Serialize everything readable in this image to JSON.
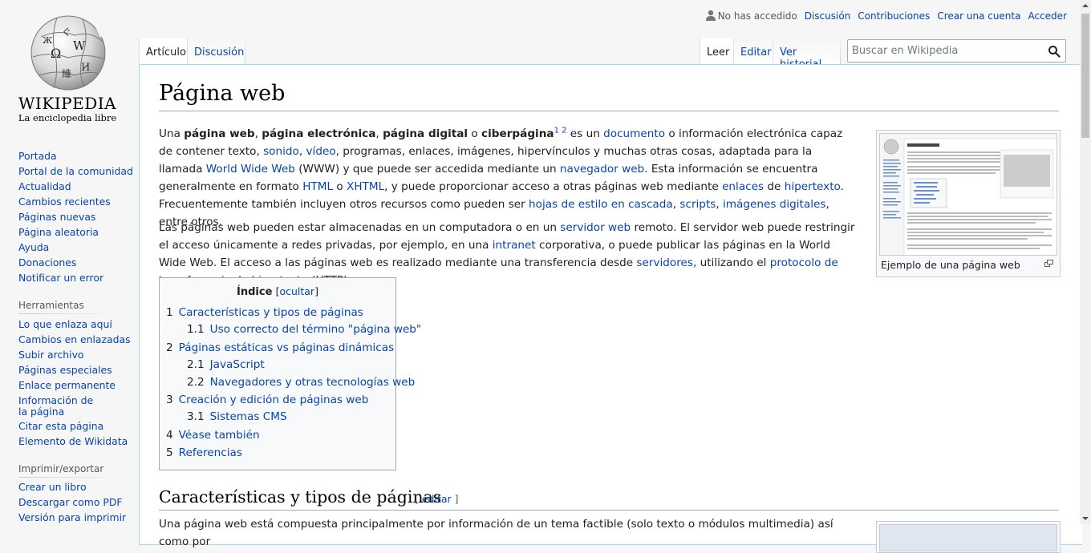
{
  "logo": {
    "wordmark": "WIKIPEDIA",
    "tagline": "La enciclopedia libre"
  },
  "personal": {
    "not_logged": "No has accedido",
    "talk": "Discusión",
    "contributions": "Contribuciones",
    "create_account": "Crear una cuenta",
    "login": "Acceder"
  },
  "tabs": {
    "article": "Artículo",
    "talk": "Discusión",
    "read": "Leer",
    "edit": "Editar",
    "history": "Ver historial"
  },
  "search": {
    "placeholder": "Buscar en Wikipedia"
  },
  "sidebar": {
    "nav": [
      "Portada",
      "Portal de la comunidad",
      "Actualidad",
      "Cambios recientes",
      "Páginas nuevas",
      "Página aleatoria",
      "Ayuda",
      "Donaciones",
      "Notificar un error"
    ],
    "tools_heading": "Herramientas",
    "tools": [
      "Lo que enlaza aquí",
      "Cambios en enlazadas",
      "Subir archivo",
      "Páginas especiales",
      "Enlace permanente",
      "Información de la página",
      "Citar esta página",
      "Elemento de Wikidata"
    ],
    "print_heading": "Imprimir/exportar",
    "print": [
      "Crear un libro",
      "Descargar como PDF",
      "Versión para imprimir"
    ]
  },
  "article": {
    "title": "Página web",
    "p1": {
      "t1": "Una ",
      "b1": "página web",
      "t2": ", ",
      "b2": "página electrónica",
      "t3": ", ",
      "b3": "página digital",
      "t4": " o ",
      "b4": "ciberpágina",
      "ref": "1 2",
      "t5": "  es un ",
      "l1": "documento",
      "t6": " o información electrónica capaz de contener texto, ",
      "l2": "sonido",
      "t7": ", ",
      "l3": "vídeo",
      "t8": ", programas, enlaces, imágenes, hipervínculos y muchas otras cosas, adaptada para la llamada ",
      "l4": "World Wide Web",
      "t9": " (WWW) y que puede ser accedida mediante un ",
      "l5": "navegador web",
      "t10": ". Esta información se encuentra generalmente en formato ",
      "l6": "HTML",
      "t11": " o ",
      "l7": "XHTML",
      "t12": ", y puede proporcionar acceso a otras páginas web mediante ",
      "l8": "enlaces",
      "t13": " de ",
      "l9": "hipertexto",
      "t14": ". Frecuentemente también incluyen otros recursos como pueden ser ",
      "l10": "hojas de estilo en cascada",
      "t15": ", ",
      "l11": "scripts",
      "t16": ", ",
      "l12": "imágenes digitales",
      "t17": ", entre otros."
    },
    "p2": {
      "t1": "Las páginas web pueden estar almacenadas en un computadora o en un ",
      "l1": "servidor web",
      "t2": " remoto. El servidor web puede restringir el acceso únicamente a redes privadas, por ejemplo, en una ",
      "l2": "intranet",
      "t3": " corporativa, o puede publicar las páginas en la World Wide Web. El acceso a las páginas web es realizado mediante una transferencia desde ",
      "l3": "servidores",
      "t4": ", utilizando el ",
      "l4": "protocolo de transferencia de hipertexto",
      "t5": " (HTTP)."
    },
    "thumb_caption": "Ejemplo de una página web",
    "toc": {
      "title": "Índice",
      "toggle_open": "[",
      "toggle": "ocultar",
      "toggle_close": "]",
      "items": [
        {
          "num": "1",
          "text": "Características y tipos de páginas"
        },
        {
          "num": "1.1",
          "text": "Uso correcto del término \"página web\""
        },
        {
          "num": "2",
          "text": "Páginas estáticas vs páginas dinámicas"
        },
        {
          "num": "2.1",
          "text": "JavaScript"
        },
        {
          "num": "2.2",
          "text": "Navegadores y otras tecnologías web"
        },
        {
          "num": "3",
          "text": "Creación y edición de páginas web"
        },
        {
          "num": "3.1",
          "text": "Sistemas CMS"
        },
        {
          "num": "4",
          "text": "Véase también"
        },
        {
          "num": "5",
          "text": "Referencias"
        }
      ]
    },
    "section1": {
      "title": "Características y tipos de páginas",
      "edit": "editar",
      "b_open": "[ ",
      "b_close": " ]"
    },
    "p3": "Una página web está compuesta principalmente por información de un tema factible (solo texto o módulos multimedia) así como por"
  },
  "colors": {
    "link": "#0645ad",
    "border": "#a7d7f9",
    "toc_bg": "#f8f9fa"
  }
}
